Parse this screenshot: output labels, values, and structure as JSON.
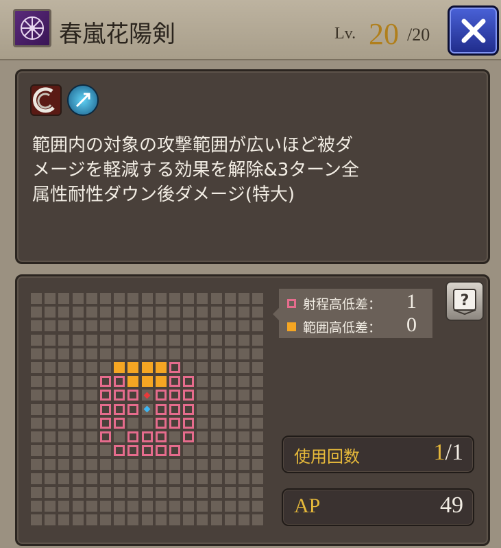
{
  "header": {
    "skill_icon": "purple-wheel-emblem-icon",
    "skill_name": "春嵐花陽剣",
    "level_prefix": "Lv.",
    "level_current": "20",
    "level_max": "/20",
    "close_icon": "close-x-icon",
    "colors": {
      "level_accent": "#b07f1c",
      "close_button": "#2f43b8"
    }
  },
  "description": {
    "effect_icons": [
      "slash-attack-icon",
      "blue-dispel-icon"
    ],
    "text": "範囲内の対象の攻撃範囲が広いほど被ダ\nメージを軽減する効果を解除&3ターン全\n属性耐性ダウン後ダメージ(特大)"
  },
  "range": {
    "legend": [
      {
        "label": "射程高低差：",
        "value": "1",
        "color": "#e66c8d"
      },
      {
        "label": "範囲高低差：",
        "value": "0",
        "color": "#f5a623"
      }
    ],
    "help_icon": "question-book-icon",
    "grid_size": [
      17,
      17
    ],
    "range_cells": [
      [
        6,
        5
      ],
      [
        7,
        5
      ],
      [
        8,
        5
      ],
      [
        9,
        5
      ],
      [
        10,
        5
      ],
      [
        5,
        6
      ],
      [
        6,
        6
      ],
      [
        7,
        6
      ],
      [
        8,
        6
      ],
      [
        9,
        6
      ],
      [
        10,
        6
      ],
      [
        11,
        6
      ],
      [
        5,
        7
      ],
      [
        6,
        7
      ],
      [
        7,
        7
      ],
      [
        9,
        7
      ],
      [
        10,
        7
      ],
      [
        11,
        7
      ],
      [
        5,
        8
      ],
      [
        6,
        8
      ],
      [
        7,
        8
      ],
      [
        9,
        8
      ],
      [
        10,
        8
      ],
      [
        11,
        8
      ],
      [
        5,
        9
      ],
      [
        6,
        9
      ],
      [
        9,
        9
      ],
      [
        10,
        9
      ],
      [
        11,
        9
      ],
      [
        5,
        10
      ],
      [
        7,
        10
      ],
      [
        8,
        10
      ],
      [
        9,
        10
      ],
      [
        11,
        10
      ],
      [
        6,
        11
      ],
      [
        7,
        11
      ],
      [
        8,
        11
      ],
      [
        9,
        11
      ],
      [
        10,
        11
      ]
    ],
    "area_cells": [
      [
        6,
        5
      ],
      [
        7,
        5
      ],
      [
        8,
        5
      ],
      [
        9,
        5
      ],
      [
        7,
        6
      ],
      [
        8,
        6
      ],
      [
        9,
        6
      ]
    ],
    "target_marker": [
      8,
      7
    ],
    "caster_marker": [
      8,
      8
    ]
  },
  "stats": {
    "uses_label": "使用回数",
    "uses_current": "1",
    "uses_max": "/1",
    "ap_label": "AP",
    "ap_value": "49"
  }
}
